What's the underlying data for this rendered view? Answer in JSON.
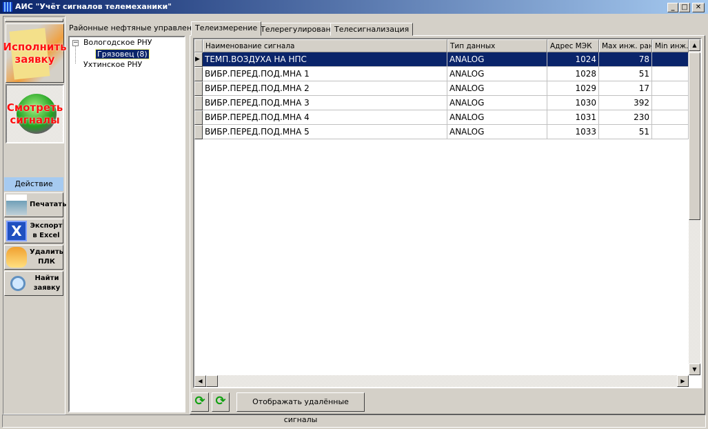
{
  "window": {
    "title": "АИС \"Учёт сигналов телемеханики\"",
    "minimize": "_",
    "maximize": "□",
    "close": "✕"
  },
  "left": {
    "execute": "Исполнить заявку",
    "view": "Смотреть сигналы",
    "action_header": "Действие",
    "actions": [
      {
        "label": "Печатать",
        "icon": "printer-icon"
      },
      {
        "label": "Экспорт в Excel",
        "icon": "excel-icon"
      },
      {
        "label": "Удалить ПЛК",
        "icon": "bucket-icon"
      },
      {
        "label": "Найти заявку",
        "icon": "magnifier-icon"
      }
    ]
  },
  "tree": {
    "label": "Районные нефтяные управления",
    "expander": "−",
    "nodes": [
      {
        "label": "Вологодское РНУ",
        "children": [
          {
            "label": "Грязовец (8)",
            "selected": true
          }
        ]
      },
      {
        "label": "Ухтинское РНУ"
      }
    ]
  },
  "tabs": [
    {
      "label": "Телеизмерение",
      "active": true
    },
    {
      "label": "Телерегулирование"
    },
    {
      "label": "Телесигнализация"
    }
  ],
  "grid": {
    "columns": [
      "Наименование сигнала",
      "Тип данных",
      "Адрес МЭК",
      "Max инж. ранг",
      "Min инж. р"
    ],
    "rows": [
      [
        "ТЕМП.ВОЗДУХА НА НПС",
        "ANALOG",
        "1024",
        "78",
        ""
      ],
      [
        "ВИБР.ПЕРЕД.ПОД.МНА 1",
        "ANALOG",
        "1028",
        "51",
        ""
      ],
      [
        "ВИБР.ПЕРЕД.ПОД.МНА 2",
        "ANALOG",
        "1029",
        "17",
        ""
      ],
      [
        "ВИБР.ПЕРЕД.ПОД.МНА 3",
        "ANALOG",
        "1030",
        "392",
        ""
      ],
      [
        "ВИБР.ПЕРЕД.ПОД.МНА 4",
        "ANALOG",
        "1031",
        "230",
        ""
      ],
      [
        "ВИБР.ПЕРЕД.ПОД.МНА 5",
        "ANALOG",
        "1033",
        "51",
        ""
      ]
    ],
    "selected_row": 0,
    "row_indicator": "▶"
  },
  "bottom": {
    "show_deleted": "Отображать удалённые сигналы",
    "refresh_icons": [
      "refresh-icon",
      "refresh-icon"
    ]
  },
  "colors": {
    "title_start": "#0a246a",
    "title_end": "#a6caf0",
    "selection": "#0a246a",
    "alert_text": "#ff1010"
  }
}
